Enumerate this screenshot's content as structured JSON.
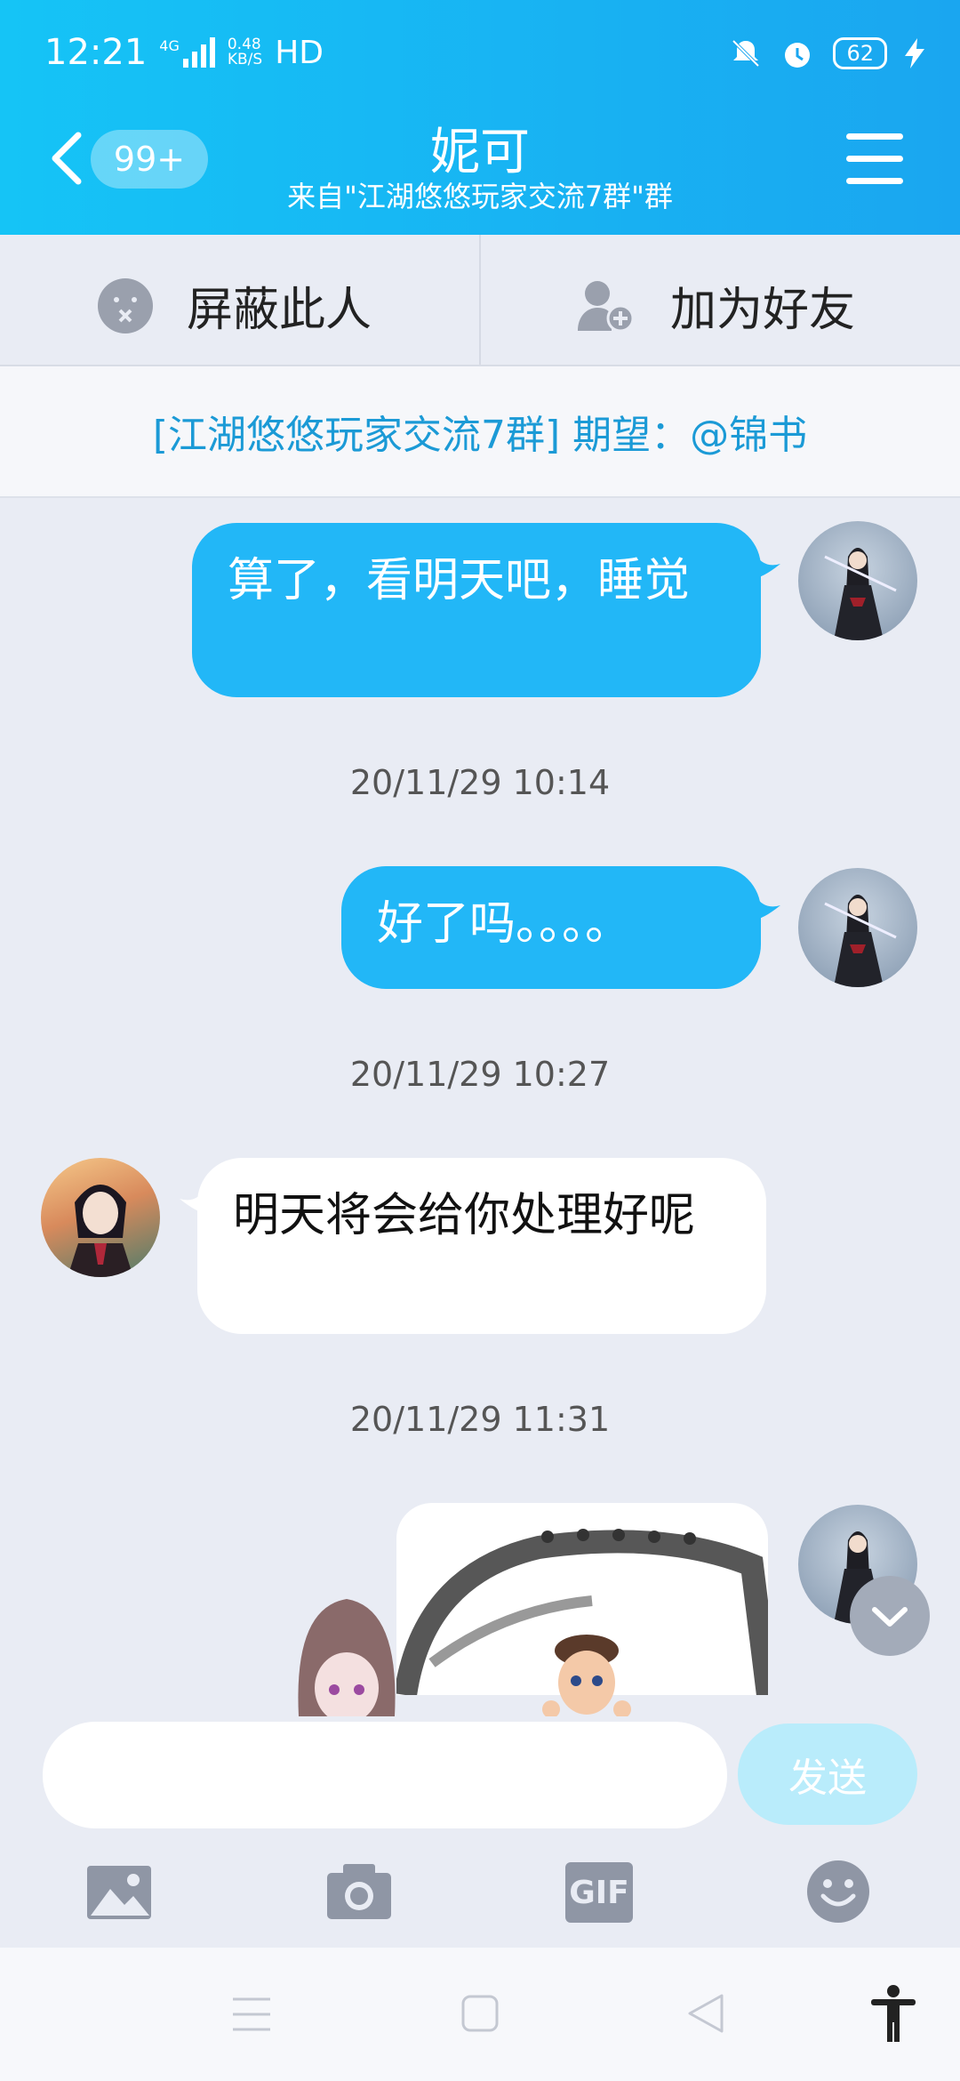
{
  "status_bar": {
    "time": "12:21",
    "network": "4G",
    "speed_value": "0.48",
    "speed_unit": "KB/S",
    "hd": "HD",
    "battery": "62"
  },
  "header": {
    "unread_badge": "99+",
    "title": "妮可",
    "subtitle": "来自\"江湖悠悠玩家交流7群\"群"
  },
  "actions": {
    "block_label": "屏蔽此人",
    "add_friend_label": "加为好友"
  },
  "notice": "[江湖悠悠玩家交流7群] 期望：@锦书",
  "messages": {
    "m1": "算了，看明天吧，睡觉",
    "t1": "20/11/29 10:14",
    "m2": "好了吗。。。。",
    "t2": "20/11/29 10:27",
    "m3": "明天将会给你处理好呢",
    "t3": "20/11/29 11:31"
  },
  "composer": {
    "send_label": "发送",
    "gif_label": "GIF"
  },
  "colors": {
    "header_start": "#15c4f6",
    "header_end": "#1aa6f0",
    "outgoing_bubble": "#22b7f7",
    "notice_text": "#1b9ad6",
    "send_button": "#b9ecfb"
  }
}
